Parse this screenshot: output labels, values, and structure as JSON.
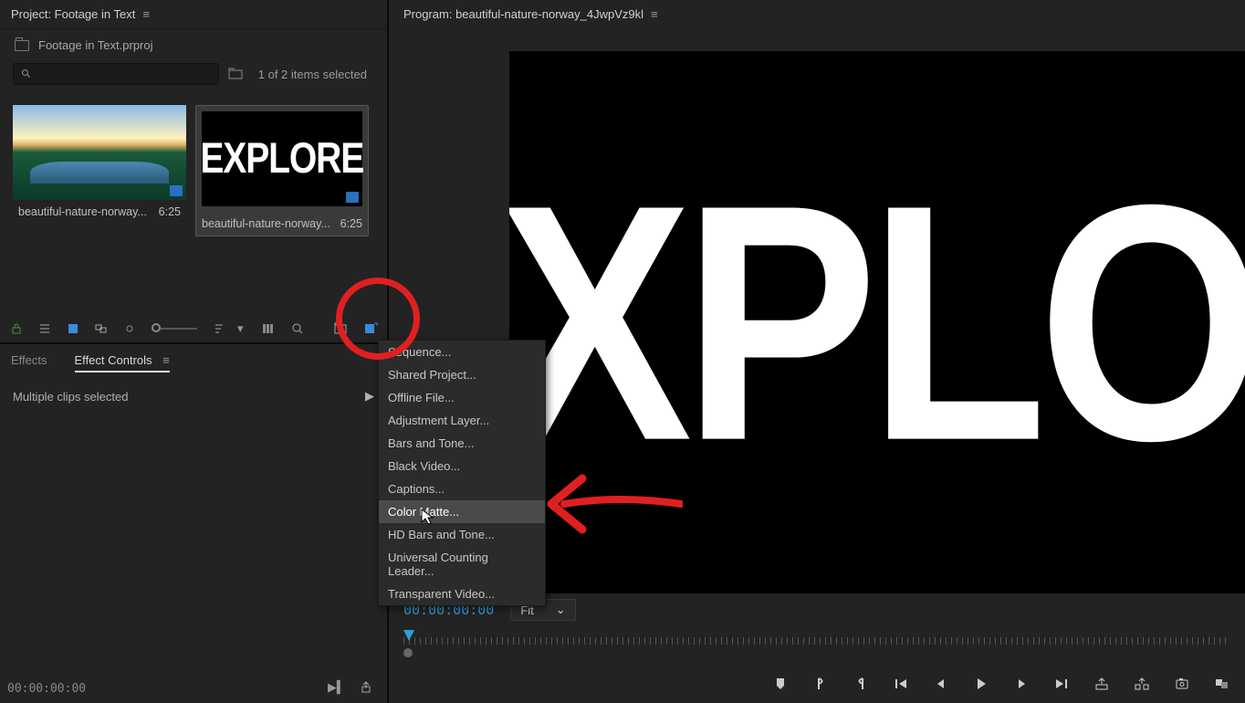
{
  "project": {
    "title": "Project: Footage in Text",
    "file_name": "Footage in Text.prproj",
    "selected_count": "1 of 2 items selected",
    "thumbs": [
      {
        "name": "beautiful-nature-norway...",
        "duration": "6:25"
      },
      {
        "name": "beautiful-nature-norway...",
        "duration": "6:25",
        "text": "EXPLORE"
      }
    ],
    "toolbar_icons": {
      "lock": "lock-icon",
      "list": "list-view-icon",
      "icon": "icon-view-icon",
      "freeform": "freeform-view-icon",
      "zoom_circle": "zoom-circle-icon",
      "sort": "sort-icon",
      "auto": "automate-icon",
      "find": "find-icon",
      "new_bin": "new-bin-icon",
      "new_item": "new-item-icon"
    }
  },
  "effects_panel": {
    "tabs": {
      "effects": "Effects",
      "effect_controls": "Effect Controls"
    },
    "status": "Multiple clips selected",
    "timecode": "00:00:00:00"
  },
  "program": {
    "title": "Program: beautiful-nature-norway_4JwpVz9kl",
    "timecode": "00:00:00:00",
    "fit_label": "Fit",
    "monitor_text": "EXPLORE"
  },
  "context_menu": {
    "items": [
      "Sequence...",
      "Shared Project...",
      "Offline File...",
      "Adjustment Layer...",
      "Bars and Tone...",
      "Black Video...",
      "Captions...",
      "Color Matte...",
      "HD Bars and Tone...",
      "Universal Counting Leader...",
      "Transparent Video..."
    ],
    "highlighted_index": 7
  },
  "colors": {
    "accent": "#2b9fd8",
    "annotation": "#e02020"
  }
}
